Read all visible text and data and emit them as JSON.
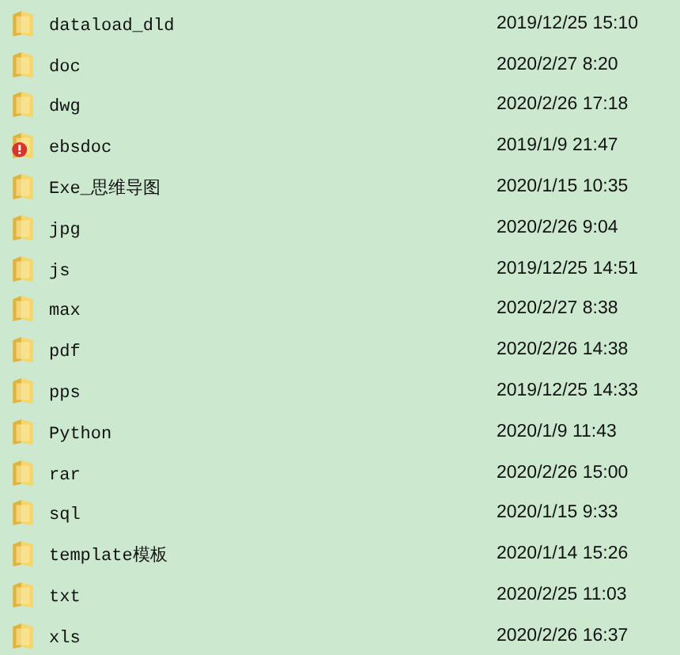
{
  "files": [
    {
      "name": "dataload_dld",
      "modified": "2019/12/25 15:10",
      "kind": "folder"
    },
    {
      "name": "doc",
      "modified": "2020/2/27 8:20",
      "kind": "folder"
    },
    {
      "name": "dwg",
      "modified": "2020/2/26 17:18",
      "kind": "folder"
    },
    {
      "name": "ebsdoc",
      "modified": "2019/1/9 21:47",
      "kind": "warning-folder"
    },
    {
      "name": "Exe_思维导图",
      "modified": "2020/1/15 10:35",
      "kind": "folder"
    },
    {
      "name": "jpg",
      "modified": "2020/2/26 9:04",
      "kind": "folder"
    },
    {
      "name": "js",
      "modified": "2019/12/25 14:51",
      "kind": "folder"
    },
    {
      "name": "max",
      "modified": "2020/2/27 8:38",
      "kind": "folder"
    },
    {
      "name": "pdf",
      "modified": "2020/2/26 14:38",
      "kind": "folder"
    },
    {
      "name": "pps",
      "modified": "2019/12/25 14:33",
      "kind": "folder"
    },
    {
      "name": "Python",
      "modified": "2020/1/9 11:43",
      "kind": "folder"
    },
    {
      "name": "rar",
      "modified": "2020/2/26 15:00",
      "kind": "folder"
    },
    {
      "name": "sql",
      "modified": "2020/1/15 9:33",
      "kind": "folder"
    },
    {
      "name": "template模板",
      "modified": "2020/1/14 15:26",
      "kind": "folder"
    },
    {
      "name": "txt",
      "modified": "2020/2/25 11:03",
      "kind": "folder"
    },
    {
      "name": "xls",
      "modified": "2020/2/26 16:37",
      "kind": "folder"
    }
  ]
}
